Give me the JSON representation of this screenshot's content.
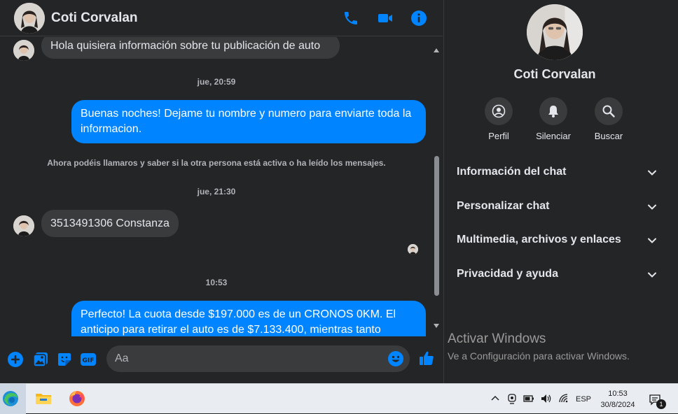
{
  "header": {
    "contact_name": "Coti Corvalan"
  },
  "messages": {
    "first_in": "Hola quisiera información sobre tu publicación de auto",
    "ts1": "jue, 20:59",
    "out1": "Buenas noches! Dejame tu nombre y  numero para enviarte toda la informacion.",
    "notice": "Ahora podéis llamaros y saber si la otra persona está activa o ha leído los mensajes.",
    "ts2": "jue, 21:30",
    "in2": "3513491306 Constanza",
    "ts3": "10:53",
    "out2": "Perfecto! La cuota desde $197.000 es de un CRONOS 0KM. El anticipo para retirar el auto es de $7.133.400, mientras tanto"
  },
  "composer": {
    "placeholder": "Aa"
  },
  "right_panel": {
    "name": "Coti Corvalan",
    "actions": [
      {
        "label": "Perfil",
        "icon": "profile-icon"
      },
      {
        "label": "Silenciar",
        "icon": "bell-icon"
      },
      {
        "label": "Buscar",
        "icon": "search-icon"
      }
    ],
    "sections": [
      {
        "label": "Información del chat"
      },
      {
        "label": "Personalizar chat"
      },
      {
        "label": "Multimedia, archivos y enlaces"
      },
      {
        "label": "Privacidad y ayuda"
      }
    ],
    "watermark_title": "Activar Windows",
    "watermark_sub": "Ve a Configuración para activar Windows."
  },
  "taskbar": {
    "language": "ESP",
    "time": "10:53",
    "date": "30/8/2024",
    "notification_count": "1"
  },
  "colors": {
    "accent": "#0084ff",
    "background": "#242526",
    "bubble_in": "#3a3b3c"
  }
}
